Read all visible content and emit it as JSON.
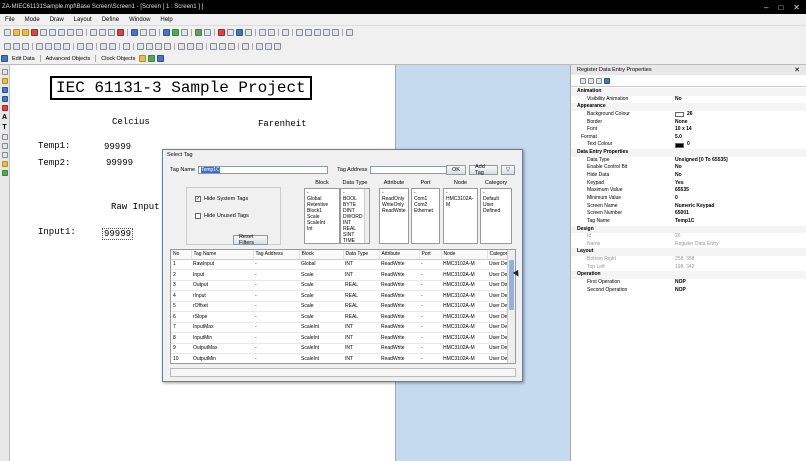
{
  "window": {
    "title": "ZA-MIEC61131Sample.mpf\\Base Screen\\Screen1 - [Screen [ 1 : Screen1 ] ]"
  },
  "menu": [
    "File",
    "Mode",
    "Draw",
    "Layout",
    "Define",
    "Window",
    "Help"
  ],
  "toolbar3": {
    "edit_data": "Edit Data",
    "advanced_objects": "Advanced Objects",
    "clock_objects": "Clock Objects"
  },
  "canvas": {
    "title": "IEC 61131-3 Sample Project",
    "celcius": "Celcius",
    "farenheit": "Farenheit",
    "temp1_label": "Temp1:",
    "temp1_value": "99999",
    "temp2_label": "Temp2:",
    "temp2_value": "99999",
    "raw_input": "Raw Input",
    "input1_label": "Input1:",
    "input1_value": "99999"
  },
  "properties": {
    "title": "Register Data Entry Properties",
    "rows": [
      {
        "kind": "cat",
        "name": "Animation"
      },
      {
        "kind": "row",
        "name": "Visibility Animation",
        "value": "No"
      },
      {
        "kind": "cat",
        "name": "Appearance"
      },
      {
        "kind": "row",
        "name": "Background Colour",
        "value": "26",
        "swatch": "#ffffff"
      },
      {
        "kind": "row",
        "name": "Border",
        "value": "None"
      },
      {
        "kind": "row",
        "name": "Font",
        "value": "10 x 14"
      },
      {
        "kind": "exp",
        "name": "Format",
        "value": "5.0"
      },
      {
        "kind": "row",
        "name": "Text Colour",
        "value": "0",
        "swatch": "#000000"
      },
      {
        "kind": "cat",
        "name": "Data Entry Properties"
      },
      {
        "kind": "row",
        "name": "Data Type",
        "value": "Unsigned [0 To 65535]"
      },
      {
        "kind": "row",
        "name": "Enable Control Bit",
        "value": "No"
      },
      {
        "kind": "row",
        "name": "Hide Data",
        "value": "No"
      },
      {
        "kind": "row",
        "name": "Keypad",
        "value": "Yes"
      },
      {
        "kind": "row",
        "name": "Maximum Value",
        "value": "65535"
      },
      {
        "kind": "row",
        "name": "Minimum Value",
        "value": "0"
      },
      {
        "kind": "row",
        "name": "Screen Name",
        "value": "Numeric Keypad"
      },
      {
        "kind": "row",
        "name": "Screen Number",
        "value": "65001"
      },
      {
        "kind": "row",
        "name": "Tag Name",
        "value": "Temp1C"
      },
      {
        "kind": "cat",
        "name": "Design"
      },
      {
        "kind": "gray",
        "name": "Id",
        "value": "26"
      },
      {
        "kind": "gray",
        "name": "Name",
        "value": "Register Data Entry"
      },
      {
        "kind": "cat",
        "name": "Layout"
      },
      {
        "kind": "gray",
        "name": "Bottom Right",
        "value": "258, 358"
      },
      {
        "kind": "gray",
        "name": "Top Left",
        "value": "198, 342"
      },
      {
        "kind": "cat",
        "name": "Operation"
      },
      {
        "kind": "row",
        "name": "First Operation",
        "value": "NOP"
      },
      {
        "kind": "row",
        "name": "Second Operation",
        "value": "NOP"
      }
    ]
  },
  "dialog": {
    "title": "Select Tag",
    "tag_name_label": "Tag Name",
    "tag_name_value": "Temp1C",
    "tag_address_label": "Tag Address",
    "ok": "OK",
    "add_tag": "Add Tag",
    "hide_system": "Hide System Tags",
    "hide_unused": "Hide Unused Tags",
    "reset_filters": "Reset Filters",
    "filters": [
      {
        "header": "Block",
        "items": [
          "-",
          "Global",
          "Retentive",
          "Block1",
          "Scale",
          "ScaleInt",
          "Int"
        ]
      },
      {
        "header": "Data Type",
        "items": [
          "-",
          "BOOL",
          "BYTE",
          "DINT",
          "DWORD",
          "INT",
          "REAL",
          "SINT",
          "TIME"
        ]
      },
      {
        "header": "Attribute",
        "items": [
          "-",
          "ReadOnly",
          "WriteOnly",
          "ReadWrite"
        ]
      },
      {
        "header": "Port",
        "items": [
          "-",
          "Com1",
          "Com2",
          "Ethernet"
        ]
      },
      {
        "header": "Node",
        "items": [
          "-",
          "HMC3102A-M"
        ]
      },
      {
        "header": "Category",
        "items": [
          "-",
          "Default",
          "User Defined"
        ]
      }
    ],
    "columns": [
      "No",
      "Tag Name",
      "Tag Address",
      "Block",
      "Data Type",
      "Attribute",
      "Port",
      "Node",
      "Category"
    ],
    "rows": [
      [
        "1",
        "RawInput",
        "-",
        "Global",
        "INT",
        "ReadWrite",
        "-",
        "HMC3102A-M",
        "User Defined"
      ],
      [
        "2",
        "Input",
        "-",
        "Scale",
        "INT",
        "ReadWrite",
        "-",
        "HMC3102A-M",
        "User Defined"
      ],
      [
        "3",
        "Output",
        "-",
        "Scale",
        "REAL",
        "ReadWrite",
        "-",
        "HMC3102A-M",
        "User Defined"
      ],
      [
        "4",
        "rInput",
        "-",
        "Scale",
        "REAL",
        "ReadWrite",
        "-",
        "HMC3102A-M",
        "User Defined"
      ],
      [
        "5",
        "rOffset",
        "-",
        "Scale",
        "REAL",
        "ReadWrite",
        "-",
        "HMC3102A-M",
        "User Defined"
      ],
      [
        "6",
        "rSlope",
        "-",
        "Scale",
        "REAL",
        "ReadWrite",
        "-",
        "HMC3102A-M",
        "User Defined"
      ],
      [
        "7",
        "InputMax",
        "-",
        "ScaleInt",
        "INT",
        "ReadWrite",
        "-",
        "HMC3102A-M",
        "User Defined"
      ],
      [
        "8",
        "InputMin",
        "-",
        "ScaleInt",
        "INT",
        "ReadWrite",
        "-",
        "HMC3102A-M",
        "User Defined"
      ],
      [
        "9",
        "OutputMax",
        "-",
        "ScaleInt",
        "INT",
        "ReadWrite",
        "-",
        "HMC3102A-M",
        "User Defined"
      ],
      [
        "10",
        "OutputMin",
        "-",
        "ScaleInt",
        "INT",
        "ReadWrite",
        "-",
        "HMC3102A-M",
        "User Defined"
      ]
    ]
  }
}
